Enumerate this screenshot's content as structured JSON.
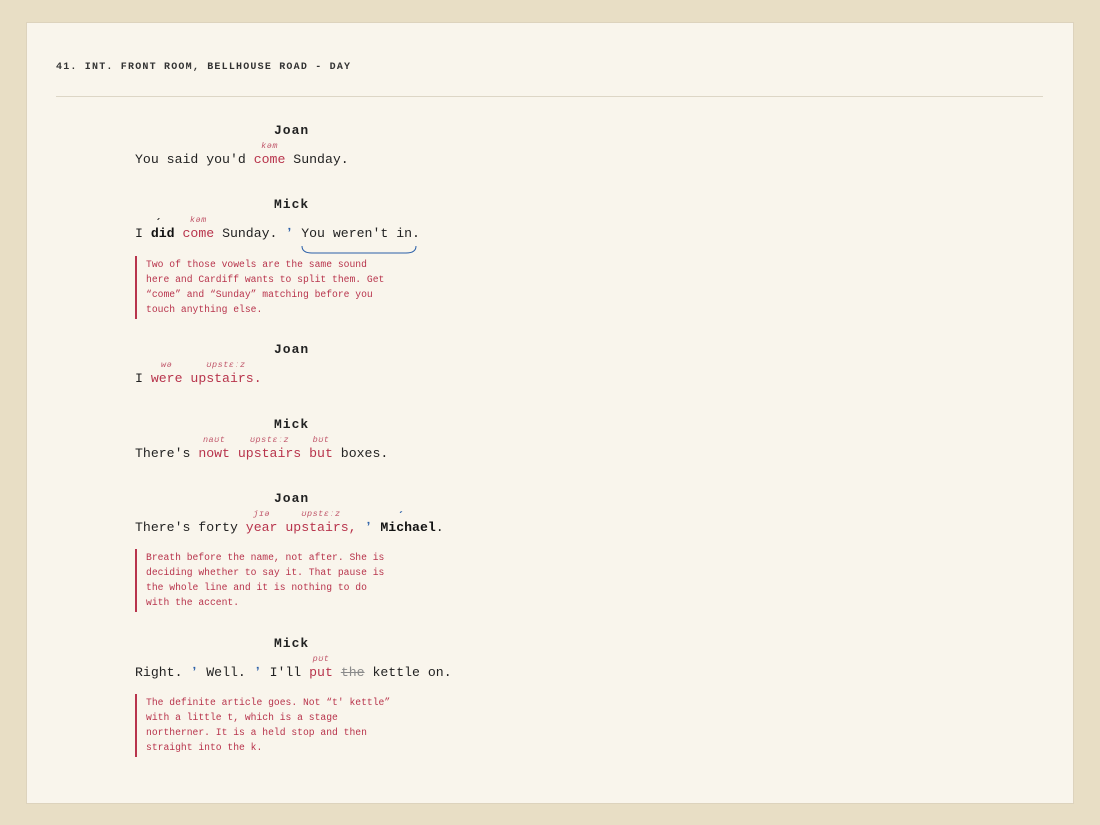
{
  "scene_heading": "41. INT. FRONT ROOM, BELLHOUSE ROAD - DAY",
  "dialogue": [
    {
      "character": "Joan",
      "line": {
        "t1": "You said you'd ",
        "w1": "come",
        "i1": "kəm",
        "t2": " Sunday."
      }
    },
    {
      "character": "Mick",
      "line": {
        "t0": "I ",
        "stressed": "did",
        "accent": "ˊ",
        "t1": " ",
        "w1": "come",
        "i1": "kəm",
        "t2": " Sunday. ",
        "break": "ʼ",
        "t3": " You weren't in."
      },
      "note": "Two of those vowels are the same sound here and Cardiff wants to split them. Get “come” and “Sunday” matching before you touch anything else."
    },
    {
      "character": "Joan",
      "line": {
        "t0": "I ",
        "w1": "were",
        "i1": "wə",
        "t1": " ",
        "w2": "upstairs.",
        "i2": "ʊpstɛːz"
      }
    },
    {
      "character": "Mick",
      "line": {
        "t0": "There's ",
        "w1": "nowt",
        "i1": "naʊt",
        "t1": " ",
        "w2": "upstairs",
        "i2": "ʊpstɛːz",
        "t2": " ",
        "w3": "but",
        "i3": "bʊt",
        "t3": " boxes."
      }
    },
    {
      "character": "Joan",
      "line": {
        "t0": "There's forty ",
        "w1": "year",
        "i1": "jɪə",
        "t1": " ",
        "w2": "upstairs,",
        "i2": "ʊpstɛːz",
        "t2": " ",
        "break": "ʼ",
        "t3": " ",
        "name": "Michael",
        "accent": "ˊ",
        "t4": "."
      },
      "note": "Breath before the name, not after. She is deciding whether to say it. That pause is the whole line and it is nothing to do with the accent."
    },
    {
      "character": "Mick",
      "line": {
        "t0": "Right. ",
        "b1": "ʼ",
        "t1": " Well. ",
        "b2": "ʼ",
        "t2": " I'll ",
        "w1": "put",
        "i1": "pʊt",
        "t3": " ",
        "cut": "the",
        "t4": " kettle on."
      },
      "note": "The definite article goes. Not “t' kettle” with a little t, which is a stage northerner. It is a held stop and then straight into the k."
    }
  ],
  "colors": {
    "page": "#f9f5ec",
    "background": "#e8dec5",
    "accent": "#b8344c",
    "break": "#2a5fa8"
  }
}
